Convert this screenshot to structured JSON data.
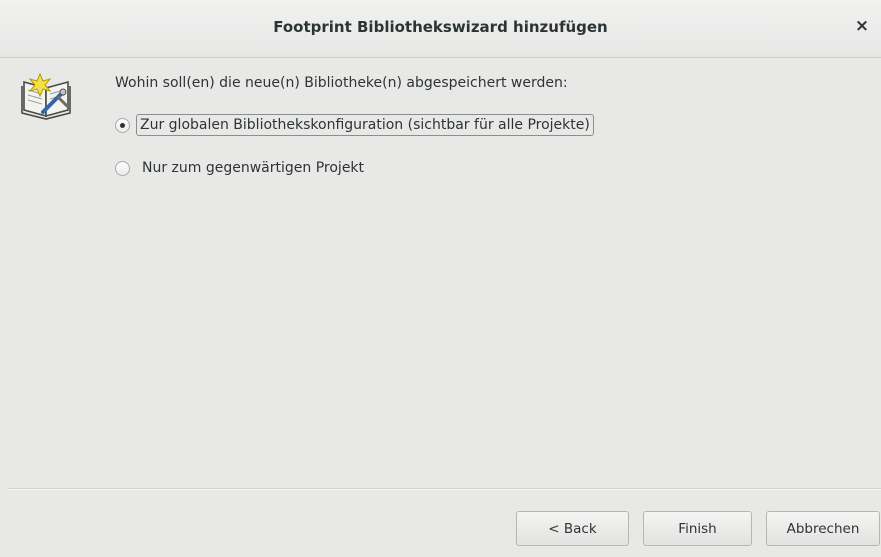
{
  "dialog": {
    "title": "Footprint Bibliothekswizard hinzufügen",
    "close_glyph": "×"
  },
  "content": {
    "question": "Wohin soll(en) die neue(n) Bibliotheke(n) abgespeichert werden:",
    "options": [
      {
        "label": "Zur globalen Bibliothekskonfiguration (sichtbar für alle Projekte)",
        "selected": true
      },
      {
        "label": "Nur zum gegenwärtigen Projekt",
        "selected": false
      }
    ]
  },
  "buttons": {
    "back": "< Back",
    "finish": "Finish",
    "cancel": "Abbrechen"
  },
  "icons": {
    "wizard": "wizard-book-icon",
    "close": "close-icon",
    "radio_selected": "radio-selected-icon",
    "radio_unselected": "radio-unselected-icon"
  }
}
